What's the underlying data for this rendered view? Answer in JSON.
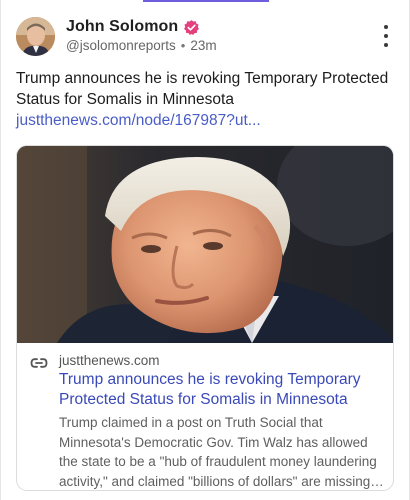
{
  "post": {
    "author": {
      "name": "John Solomon",
      "handle": "@jsolomonreports",
      "time": "23m",
      "verified": true
    },
    "text": "Trump announces he is revoking Temporary Protected Status for Somalis in Minnesota ",
    "link_text": "justthenews.com/node/167987?ut..."
  },
  "link_card": {
    "domain": "justthenews.com",
    "title": "Trump announces he is revoking Temporary Protected Status for Somalis in Minnesota",
    "description": "Trump claimed in a post on Truth Social that Minnesota's Democratic Gov. Tim Walz has allowed the state to be a \"hub of fraudulent money laundering activity,\" and claimed \"billions of dollars\" are missing in Minnesota."
  },
  "icons": {
    "verified": "verified-badge-icon",
    "more": "more-vertical-icon",
    "link": "link-icon"
  },
  "colors": {
    "accent": "#6f5de0",
    "verified_badge": "#e4407f",
    "link": "#4a5cc7",
    "card_title": "#3a49b8"
  }
}
